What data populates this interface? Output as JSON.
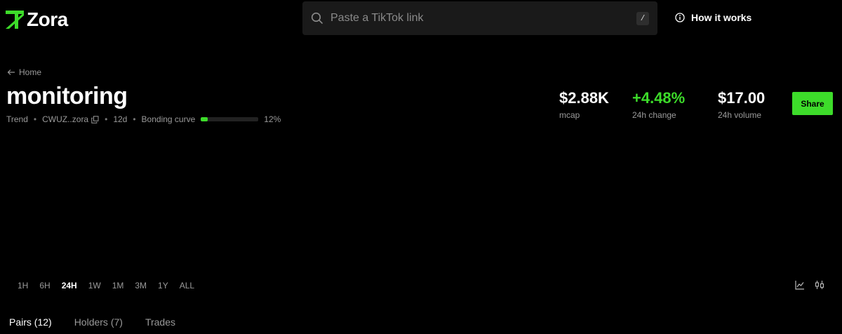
{
  "brand": {
    "name": "Zora",
    "logo_icon": "zora-logo-icon",
    "accent": "#3ddc2a"
  },
  "search": {
    "placeholder": "Paste a TikTok link",
    "shortcut": "/"
  },
  "header": {
    "how_label": "How it works",
    "how_icon": "info-icon"
  },
  "breadcrumb": {
    "label": "Home",
    "icon": "arrow-left-icon"
  },
  "token": {
    "title": "monitoring",
    "meta": {
      "category": "Trend",
      "address": "CWUZ..zora",
      "age": "12d",
      "bonding_label": "Bonding curve",
      "bonding_progress": 0.12,
      "bonding_pct": "12%"
    }
  },
  "stats": {
    "mcap_value": "$2.88K",
    "mcap_label": "mcap",
    "change_value": "+4.48%",
    "change_label": "24h change",
    "volume_value": "$17.00",
    "volume_label": "24h volume"
  },
  "share_label": "Share",
  "ranges": [
    "1H",
    "6H",
    "24H",
    "1W",
    "1M",
    "3M",
    "1Y",
    "ALL"
  ],
  "active_range": "24H",
  "chart_tools": [
    "line-chart-icon",
    "candlestick-icon"
  ],
  "tabs": [
    "Pairs (12)",
    "Holders (7)",
    "Trades"
  ],
  "active_tab": "Pairs (12)"
}
